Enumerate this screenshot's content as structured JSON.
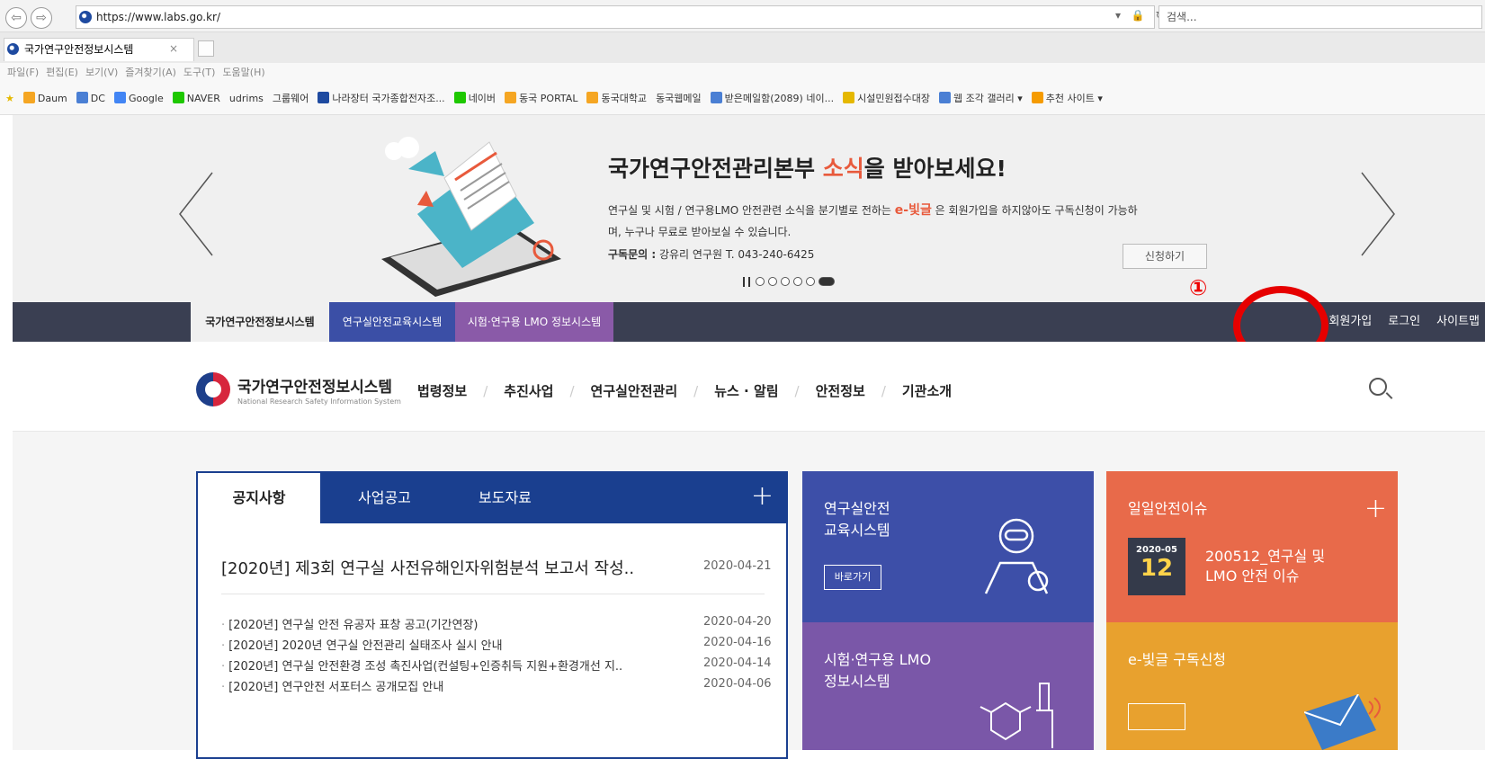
{
  "browser": {
    "url": "https://www.labs.go.kr/",
    "search_placeholder": "검색...",
    "tab_title": "국가연구안전정보시스템",
    "tab_close": "×",
    "back_glyph": "⇦",
    "forward_glyph": "⇨",
    "addr_icons": "▾ 🔒 ↻",
    "menu": [
      "파일(F)",
      "편집(E)",
      "보기(V)",
      "즐겨찾기(A)",
      "도구(T)",
      "도움말(H)"
    ],
    "favorites": [
      {
        "label": "Daum",
        "color": "#f5a623"
      },
      {
        "label": "DC",
        "color": "#4a7fd4"
      },
      {
        "label": "Google",
        "color": "#4285f4"
      },
      {
        "label": "NAVER",
        "color": "#1ec800"
      },
      {
        "label": "udrims",
        "color": ""
      },
      {
        "label": "그룹웨어",
        "color": ""
      },
      {
        "label": "나라장터 국가종합전자조...",
        "color": "#1e4aa0"
      },
      {
        "label": "네이버",
        "color": "#1ec800"
      },
      {
        "label": "동국 PORTAL",
        "color": "#f5a623"
      },
      {
        "label": "동국대학교",
        "color": "#f5a623"
      },
      {
        "label": "동국웹메일",
        "color": ""
      },
      {
        "label": "받은메일함(2089) 네이...",
        "color": "#4a7fd4"
      },
      {
        "label": "시설민원접수대장",
        "color": "#e5b800"
      },
      {
        "label": "웹 조각 갤러리 ▾",
        "color": "#4a7fd4"
      },
      {
        "label": "추천 사이트 ▾",
        "color": "#f59b00"
      }
    ]
  },
  "banner": {
    "title_pre": "국가연구안전관리본부 ",
    "title_accent": "소식",
    "title_post": "을 받아보세요!",
    "desc_pre": "연구실 및 시험 / 연구용LMO 안전관련 소식을 분기별로 전하는 ",
    "desc_accent": "e-빛글",
    "desc_post": " 은 회원가입을 하지않아도 구독신청이 가능하며, 누구나 무료로 받아보실 수 있습니다.",
    "contact_label": "구독문의 :",
    "contact_text": " 강유리 연구원 T. 043-240-6425",
    "apply_button": "신청하기",
    "prev_arrow": "〈",
    "next_arrow": "〉",
    "slide_count": 6,
    "active_slide": 5
  },
  "system_nav": {
    "tabs": [
      "국가연구안전정보시스템",
      "연구실안전교육시스템",
      "시험·연구용 LMO 정보시스템"
    ],
    "links": [
      "회원가입",
      "로그인",
      "사이트맵"
    ],
    "step_marker": "①",
    "colors": {
      "bar": "#3a3f52",
      "edu": "#3b4fa6",
      "lmo": "#8a5aa8",
      "highlight": "#e60000"
    }
  },
  "header": {
    "logo_title": "국가연구안전정보시스템",
    "logo_sub": "National Research Safety Information System",
    "menu": [
      "법령정보",
      "추진사업",
      "연구실안전관리",
      "뉴스 · 알림",
      "안전정보",
      "기관소개"
    ],
    "separator": "/"
  },
  "notice": {
    "tabs": [
      "공지사항",
      "사업공고",
      "보도자료"
    ],
    "plus": "+",
    "headline": "[2020년] 제3회 연구실 사전유해인자위험분석 보고서 작성..",
    "headline_date": "2020-04-21",
    "items": [
      {
        "title": "[2020년] 연구실 안전 유공자 표창 공고(기간연장)",
        "date": "2020-04-20"
      },
      {
        "title": "[2020년] 2020년 연구실 안전관리 실태조사 실시 안내",
        "date": "2020-04-16"
      },
      {
        "title": "[2020년] 연구실 안전환경 조성 촉진사업(컨설팅+인증취득 지원+환경개선 지..",
        "date": "2020-04-14"
      },
      {
        "title": "[2020년] 연구안전 서포터스 공개모집 안내",
        "date": "2020-04-06"
      }
    ],
    "bullet": "·"
  },
  "tiles": {
    "edu": {
      "title_line1": "연구실안전",
      "title_line2": "교육시스템",
      "button": "바로가기"
    },
    "lmo": {
      "title_line1": "시험·연구용 LMO",
      "title_line2": "정보시스템"
    },
    "issue": {
      "title": "일일안전이슈",
      "plus": "+",
      "date_ym": "2020-05",
      "date_d": "12",
      "text_line1": "200512_연구실 및",
      "text_line2": "LMO 안전 이슈"
    },
    "subscribe": {
      "title": "e-빛글 구독신청"
    }
  }
}
